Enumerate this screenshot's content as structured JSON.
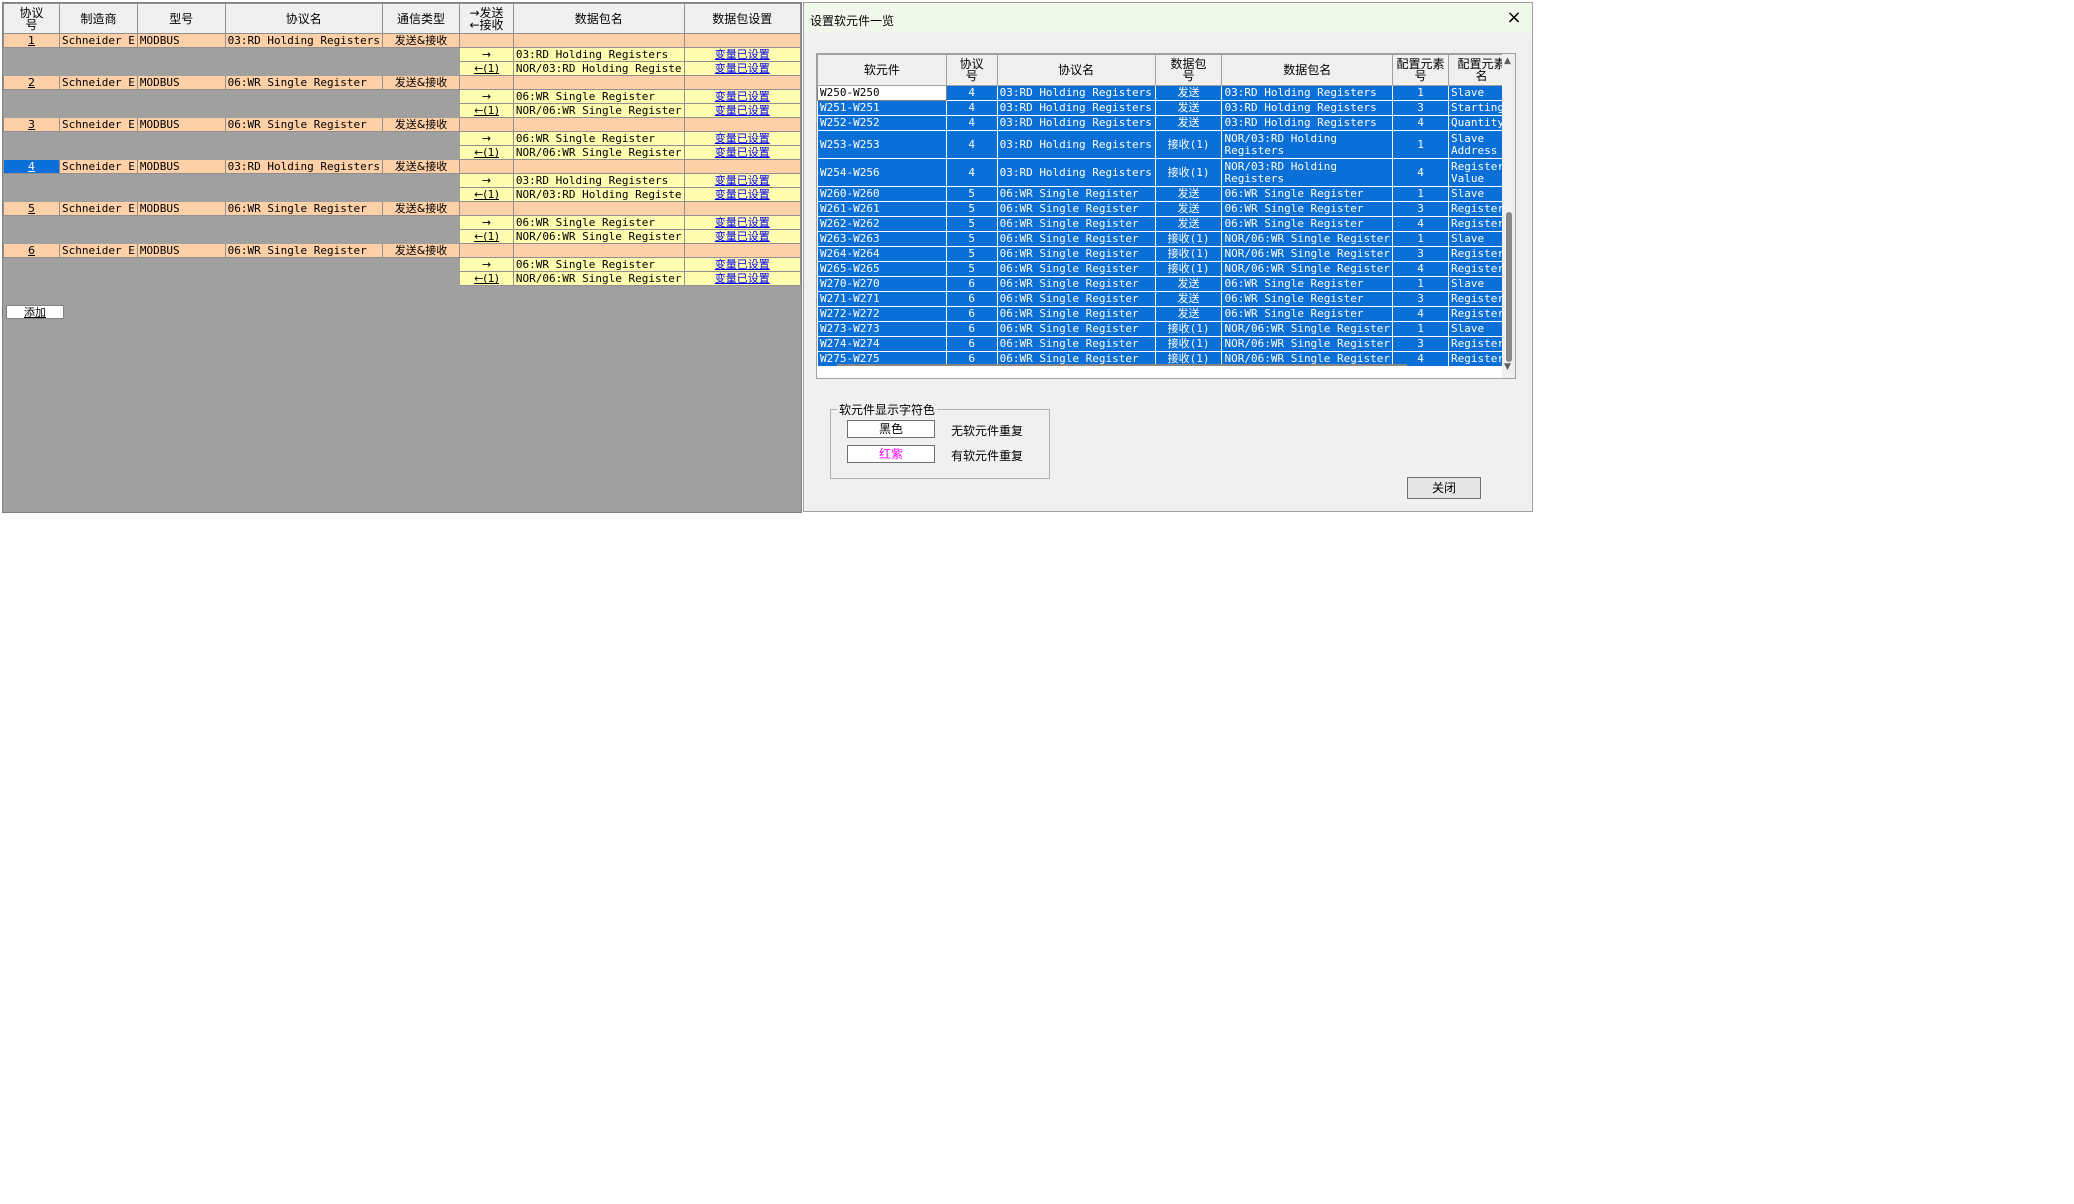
{
  "proto_table": {
    "headers": [
      "协议\n号",
      "制造商",
      "型号",
      "协议名",
      "通信类型",
      "→发送\n←接收",
      "数据包名",
      "数据包设置"
    ],
    "rows": [
      {
        "no": "1",
        "maker": "Schneider E",
        "model": "MODBUS",
        "proto": "03:RD Holding Registers",
        "comm": "发送&接收",
        "packets": [
          {
            "dir": "→",
            "name": "03:RD Holding Registers",
            "set": "变量已设置"
          },
          {
            "dir": "←(1)",
            "name": "NOR/03:RD Holding Registe",
            "set": "变量已设置"
          }
        ]
      },
      {
        "no": "2",
        "maker": "Schneider E",
        "model": "MODBUS",
        "proto": "06:WR Single Register",
        "comm": "发送&接收",
        "packets": [
          {
            "dir": "→",
            "name": "06:WR Single Register",
            "set": "变量已设置"
          },
          {
            "dir": "←(1)",
            "name": "NOR/06:WR Single Register",
            "set": "变量已设置"
          }
        ]
      },
      {
        "no": "3",
        "maker": "Schneider E",
        "model": "MODBUS",
        "proto": "06:WR Single Register",
        "comm": "发送&接收",
        "packets": [
          {
            "dir": "→",
            "name": "06:WR Single Register",
            "set": "变量已设置"
          },
          {
            "dir": "←(1)",
            "name": "NOR/06:WR Single Register",
            "set": "变量已设置"
          }
        ]
      },
      {
        "no": "4",
        "maker": "Schneider E",
        "model": "MODBUS",
        "proto": "03:RD Holding Registers",
        "comm": "发送&接收",
        "selected": true,
        "packets": [
          {
            "dir": "→",
            "name": "03:RD Holding Registers",
            "set": "变量已设置"
          },
          {
            "dir": "←(1)",
            "name": "NOR/03:RD Holding Registe",
            "set": "变量已设置"
          }
        ]
      },
      {
        "no": "5",
        "maker": "Schneider E",
        "model": "MODBUS",
        "proto": "06:WR Single Register",
        "comm": "发送&接收",
        "packets": [
          {
            "dir": "→",
            "name": "06:WR Single Register",
            "set": "变量已设置"
          },
          {
            "dir": "←(1)",
            "name": "NOR/06:WR Single Register",
            "set": "变量已设置"
          }
        ]
      },
      {
        "no": "6",
        "maker": "Schneider E",
        "model": "MODBUS",
        "proto": "06:WR Single Register",
        "comm": "发送&接收",
        "packets": [
          {
            "dir": "→",
            "name": "06:WR Single Register",
            "set": "变量已设置"
          },
          {
            "dir": "←(1)",
            "name": "NOR/06:WR Single Register",
            "set": "变量已设置"
          }
        ]
      }
    ],
    "add_label": "添加"
  },
  "dialog": {
    "title": "设置软元件一览",
    "close_icon": "×",
    "headers": [
      "软元件",
      "协议\n号",
      "协议名",
      "数据包\n号",
      "数据包名",
      "配置元素\n号",
      "配置元素\n名"
    ],
    "rows": [
      [
        "W250-W250",
        "4",
        "03:RD Holding Registers",
        "发送",
        "03:RD Holding Registers",
        "1",
        "Slave"
      ],
      [
        "W251-W251",
        "4",
        "03:RD Holding Registers",
        "发送",
        "03:RD Holding Registers",
        "3",
        "Starting"
      ],
      [
        "W252-W252",
        "4",
        "03:RD Holding Registers",
        "发送",
        "03:RD Holding Registers",
        "4",
        "Quantity"
      ],
      [
        "W253-W253",
        "4",
        "03:RD Holding Registers",
        "接收(1)",
        "NOR/03:RD Holding Registers",
        "1",
        "Slave Address"
      ],
      [
        "W254-W256",
        "4",
        "03:RD Holding Registers",
        "接收(1)",
        "NOR/03:RD Holding Registers",
        "4",
        "Register Value"
      ],
      [
        "W260-W260",
        "5",
        "06:WR Single Register",
        "发送",
        "06:WR Single Register",
        "1",
        "Slave"
      ],
      [
        "W261-W261",
        "5",
        "06:WR Single Register",
        "发送",
        "06:WR Single Register",
        "3",
        "Register"
      ],
      [
        "W262-W262",
        "5",
        "06:WR Single Register",
        "发送",
        "06:WR Single Register",
        "4",
        "Register"
      ],
      [
        "W263-W263",
        "5",
        "06:WR Single Register",
        "接收(1)",
        "NOR/06:WR Single Register",
        "1",
        "Slave"
      ],
      [
        "W264-W264",
        "5",
        "06:WR Single Register",
        "接收(1)",
        "NOR/06:WR Single Register",
        "3",
        "Register"
      ],
      [
        "W265-W265",
        "5",
        "06:WR Single Register",
        "接收(1)",
        "NOR/06:WR Single Register",
        "4",
        "Register"
      ],
      [
        "W270-W270",
        "6",
        "06:WR Single Register",
        "发送",
        "06:WR Single Register",
        "1",
        "Slave"
      ],
      [
        "W271-W271",
        "6",
        "06:WR Single Register",
        "发送",
        "06:WR Single Register",
        "3",
        "Register"
      ],
      [
        "W272-W272",
        "6",
        "06:WR Single Register",
        "发送",
        "06:WR Single Register",
        "4",
        "Register"
      ],
      [
        "W273-W273",
        "6",
        "06:WR Single Register",
        "接收(1)",
        "NOR/06:WR Single Register",
        "1",
        "Slave"
      ],
      [
        "W274-W274",
        "6",
        "06:WR Single Register",
        "接收(1)",
        "NOR/06:WR Single Register",
        "3",
        "Register"
      ],
      [
        "W275-W275",
        "6",
        "06:WR Single Register",
        "接收(1)",
        "NOR/06:WR Single Register",
        "4",
        "Register"
      ]
    ],
    "legend": {
      "title": "软元件显示字符色",
      "black_swatch": "黑色",
      "black_label": "无软元件重复",
      "magenta_swatch": "红紫",
      "magenta_label": "有软元件重复"
    },
    "close_label": "关闭",
    "colors": {
      "selection": "#0a6fd6",
      "row_orange": "#fdd0a8",
      "row_yellow": "#fffdb0",
      "magenta": "#ff00ff"
    }
  }
}
